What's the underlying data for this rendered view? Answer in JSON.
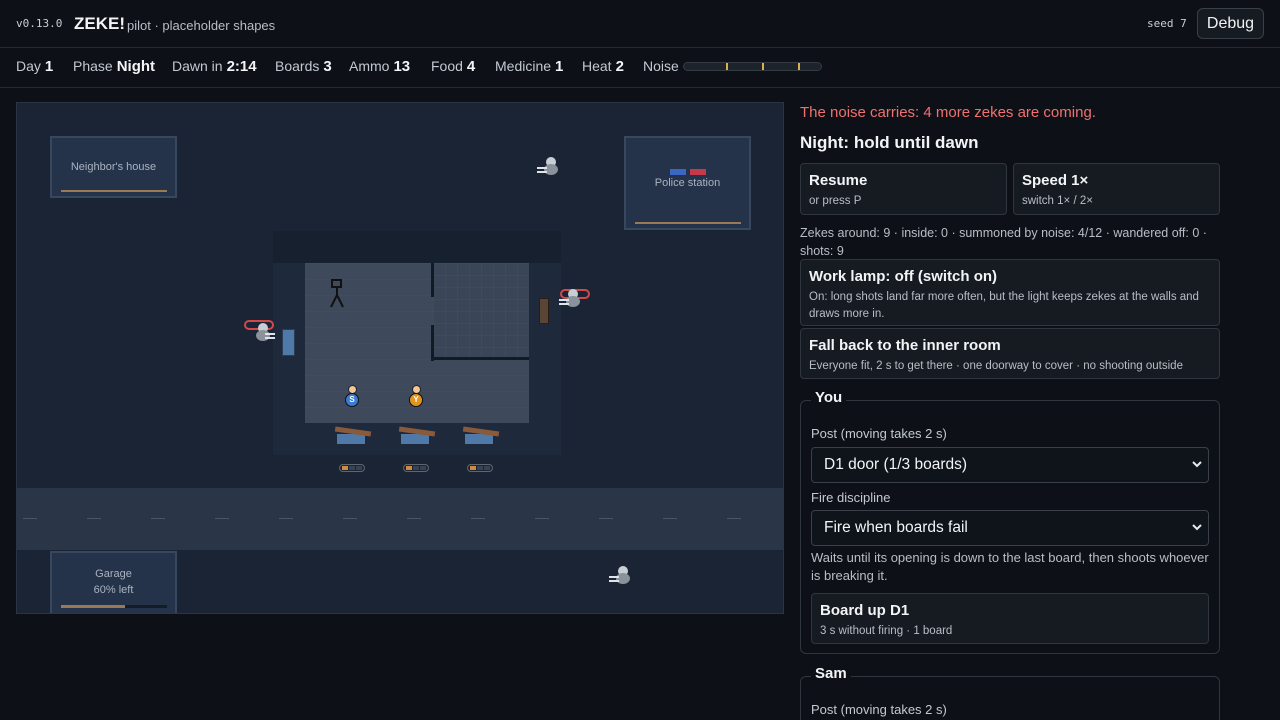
{
  "header": {
    "version": "v0.13.0",
    "app_name": "ZEKE!",
    "subtitle": "pilot · placeholder shapes",
    "seed": "seed 7",
    "debug_label": "Debug"
  },
  "stats": {
    "day_label": "Day",
    "day": "1",
    "phase_label": "Phase",
    "phase": "Night",
    "dawn_label": "Dawn in",
    "dawn": "2:14",
    "boards_label": "Boards",
    "boards": "3",
    "ammo_label": "Ammo",
    "ammo": "13",
    "food_label": "Food",
    "food": "4",
    "medicine_label": "Medicine",
    "medicine": "1",
    "heat_label": "Heat",
    "heat": "2",
    "noise_label": "Noise"
  },
  "map": {
    "neighbor_label": "Neighbor's house",
    "police_label": "Police station",
    "garage_label": "Garage",
    "garage_status": "60% left",
    "garage_remaining": 0.6,
    "survivor_s": "S",
    "survivor_y": "Y",
    "boards_per_window": [
      1,
      1,
      1
    ]
  },
  "side": {
    "alert": "The noise carries: 4 more zekes are coming.",
    "heading": "Night: hold until dawn",
    "resume_title": "Resume",
    "resume_sub": "or press P",
    "speed_title": "Speed 1×",
    "speed_sub": "switch 1× / 2×",
    "info": "Zekes around: 9 · inside: 0 · summoned by noise: 4/12 · wandered off: 0 · shots: 9",
    "lamp_title": "Work lamp: off (switch on)",
    "lamp_sub": "On: long shots land far more often, but the light keeps zekes at the walls and draws more in.",
    "fallback_title": "Fall back to the inner room",
    "fallback_sub": "Everyone fit, 2 s to get there · one doorway to cover · no shooting outside"
  },
  "you": {
    "title": "You",
    "post_label": "Post (moving takes 2 s)",
    "post_value": "D1 door (1/3 boards)",
    "fire_label": "Fire discipline",
    "fire_value": "Fire when boards fail",
    "fire_desc": "Waits until its opening is down to the last board, then shoots whoever is breaking it.",
    "board_title": "Board up D1",
    "board_sub": "3 s without firing · 1 board"
  },
  "sam": {
    "title": "Sam",
    "post_label": "Post (moving takes 2 s)"
  },
  "colors": {
    "alert": "#f07070",
    "survivor_s": "#3a7bd5",
    "survivor_y": "#e0961e",
    "noise": "#d8b14a"
  }
}
